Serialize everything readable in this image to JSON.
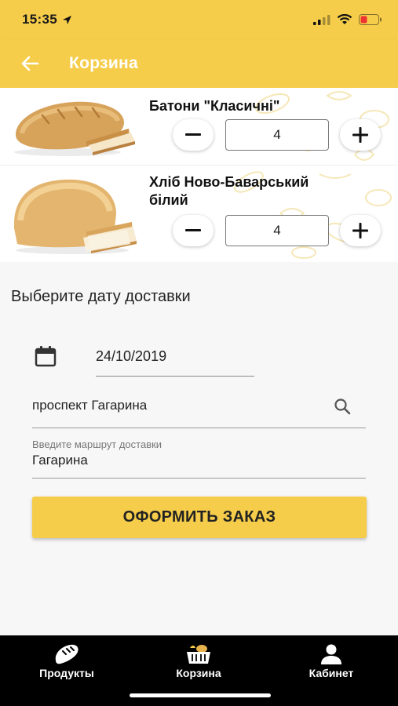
{
  "status_bar": {
    "time": "15:35"
  },
  "header": {
    "title": "Корзина"
  },
  "cart": {
    "items": [
      {
        "name": "Батони \"Класичні\"",
        "quantity": "4"
      },
      {
        "name": "Хліб Ново-Баварський білий",
        "name_line1": "Хліб Ново-Баварський",
        "name_line2": "білий",
        "quantity": "4"
      }
    ]
  },
  "delivery": {
    "section_title": "Выберите дату доставки",
    "date": "24/10/2019",
    "address": "проспект Гагарина",
    "route_label": "Введите маршрут доставки",
    "route_value": "Гагарина"
  },
  "order_button": "ОФОРМИТЬ ЗАКАЗ",
  "nav": [
    {
      "label": "Продукты",
      "icon": "bread-icon"
    },
    {
      "label": "Корзина",
      "icon": "basket-icon"
    },
    {
      "label": "Кабинет",
      "icon": "person-icon"
    }
  ],
  "colors": {
    "accent": "#f6cd4a",
    "nav_bg": "#000000"
  }
}
